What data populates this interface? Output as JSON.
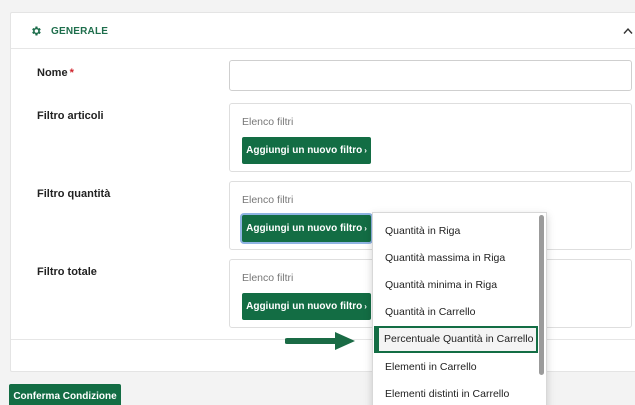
{
  "section": {
    "title": "GENERALE",
    "icon": "gear-icon",
    "toggle_icon": "chevron-up-icon"
  },
  "form": {
    "name_label": "Nome",
    "required_mark": "*",
    "name_value": "",
    "filtro_articoli": {
      "label": "Filtro articoli",
      "list_label": "Elenco filtri",
      "add_button": "Aggiungi un nuovo filtro",
      "add_button_icon": "chevron-right-icon"
    },
    "filtro_quantita": {
      "label": "Filtro quantità",
      "list_label": "Elenco filtri",
      "add_button": "Aggiungi un nuovo filtro",
      "add_button_icon": "chevron-right-icon"
    },
    "filtro_totale": {
      "label": "Filtro totale",
      "list_label": "Elenco filtri",
      "add_button": "Aggiungi un nuovo filtro",
      "add_button_icon": "chevron-right-icon"
    }
  },
  "dropdown": {
    "items": [
      "Quantità in Riga",
      "Quantità massima in Riga",
      "Quantità minima in Riga",
      "Quantità in Carrello",
      "Percentuale Quantità in Carrello",
      "Elementi in Carrello",
      "Elementi distinti in Carrello"
    ],
    "highlighted": "Percentuale Quantità in Carrello"
  },
  "footer": {
    "confirm_button": "Conferma Condizione"
  },
  "colors": {
    "accent": "#136d44",
    "header_text": "#1e6e4c",
    "required": "#d0242d"
  }
}
